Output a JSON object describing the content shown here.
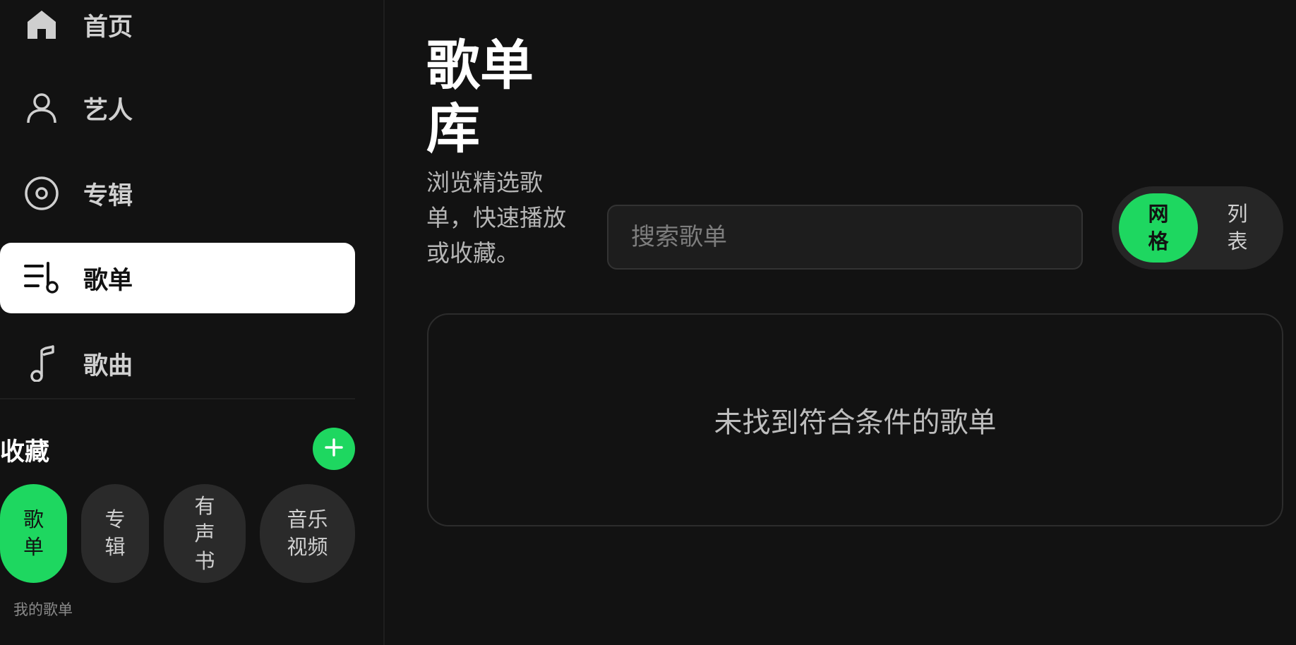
{
  "sidebar": {
    "nav": [
      {
        "label": "首页",
        "icon": "home-icon"
      },
      {
        "label": "艺人",
        "icon": "user-icon"
      },
      {
        "label": "专辑",
        "icon": "disc-icon"
      },
      {
        "label": "歌单",
        "icon": "playlist-icon",
        "active": true
      },
      {
        "label": "歌曲",
        "icon": "music-note-icon"
      }
    ],
    "favorites": {
      "title": "收藏",
      "chips": [
        {
          "label": "歌单",
          "active": true
        },
        {
          "label": "专辑"
        },
        {
          "label": "有声书"
        },
        {
          "label": "音乐视频"
        }
      ],
      "section_label": "我的歌单"
    }
  },
  "main": {
    "title": "歌单库",
    "description": "浏览精选歌单，快速播放或收藏。",
    "search_placeholder": "搜索歌单",
    "view_toggle": {
      "grid": "网格",
      "list": "列表",
      "selected": "grid"
    },
    "empty_message": "未找到符合条件的歌单"
  },
  "colors": {
    "accent": "#1ed760",
    "background": "#121212",
    "active_nav": "#ffffff"
  }
}
